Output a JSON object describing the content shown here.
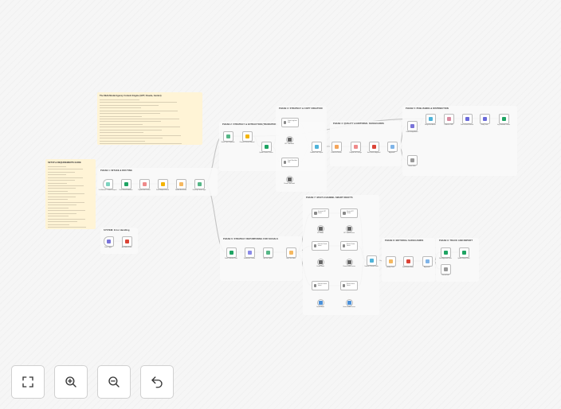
{
  "sticky_notes": [
    {
      "id": "note-main",
      "title": "The Multi-Modal Agency Content Engine (GPT, Claude, Gemini)",
      "lines": [
        "",
        "",
        "",
        "",
        "",
        "",
        "",
        "",
        "",
        "",
        "",
        "",
        "",
        "",
        "",
        "",
        "",
        ""
      ]
    },
    {
      "id": "note-setup",
      "title": "SETUP & REQUIREMENTS GUIDE",
      "lines": [
        "",
        "",
        "",
        "",
        "",
        "",
        "",
        "",
        "",
        "",
        "",
        "",
        "",
        "",
        "",
        "",
        "",
        "",
        "",
        "",
        "",
        "",
        "",
        ""
      ]
    }
  ],
  "groups": [
    {
      "id": "g1",
      "title": "PHASE 1: INTAKE & ROUTING"
    },
    {
      "id": "g2",
      "title": "PHASE 2: STRATEGY & EXTRACTION (TRANSITION)"
    },
    {
      "id": "g3",
      "title": "PHASE 3: STRATEGY & COPY CREATION"
    },
    {
      "id": "g4",
      "title": "PHASE 4: QUALITY & EDITORIAL SAFEGUARDS"
    },
    {
      "id": "g5",
      "title": "PHASE 5: PUBLISHING & DISTRIBUTION"
    },
    {
      "id": "gerr",
      "title": "SYSTEM: Error Handling"
    },
    {
      "id": "g6",
      "title": "PHASE 6: STRATEGY REPURPOSING FOR SOCIALS"
    },
    {
      "id": "g7",
      "title": "PHASE 7: MULTI-CHANNEL SMART DRAFTS"
    },
    {
      "id": "g8",
      "title": "PHASE 8: EDITORIAL SAFEGUARDS"
    },
    {
      "id": "g9",
      "title": "PHASE 9: TRACK AND REPORT"
    }
  ],
  "nodes": [
    {
      "id": "n1",
      "type": "trigger",
      "label": "On Webhook / Content Request",
      "icon": "webhook-icon",
      "color": "#7dd3c0"
    },
    {
      "id": "n2",
      "label": "Fetch Brand Guidelines",
      "icon": "sheets-icon",
      "color": "#1fa463"
    },
    {
      "id": "n3",
      "label": "Prepare Brief Context",
      "icon": "code-icon",
      "color": "#ef8a8a"
    },
    {
      "id": "n4",
      "label": "Store Request Record",
      "icon": "drive-icon",
      "color": "#f4b400"
    },
    {
      "id": "n5",
      "label": "Validate Brief Fields",
      "icon": "filter-icon",
      "color": "#f5b860"
    },
    {
      "id": "n6",
      "label": "Route By Content Type",
      "icon": "switch-icon",
      "color": "#55b686"
    },
    {
      "id": "n7",
      "label": "Extract Topic Keywords",
      "icon": "ai-icon",
      "color": "#55b686"
    },
    {
      "id": "n8",
      "label": "Research Source Material",
      "icon": "drive-icon",
      "color": "#f4b400"
    },
    {
      "id": "n9",
      "label": "Update Content Tracker",
      "icon": "sheets-icon",
      "color": "#1fa463"
    },
    {
      "id": "n10",
      "type": "agent",
      "label": "Create Long-form Draft",
      "icon": "agent-icon",
      "color": "#888"
    },
    {
      "id": "n11",
      "type": "sub",
      "label": "GPT Chat Model",
      "icon": "openai-icon",
      "color": "#666"
    },
    {
      "id": "n12",
      "type": "agent",
      "label": "Create Short-form Draft",
      "icon": "agent-icon",
      "color": "#888"
    },
    {
      "id": "n13",
      "type": "sub",
      "label": "Claude Chat Model",
      "icon": "anthropic-icon",
      "color": "#666"
    },
    {
      "id": "n14",
      "label": "Combine Draft Outputs",
      "icon": "merge-icon",
      "color": "#4fb3d9"
    },
    {
      "id": "n15",
      "label": "Format for Review",
      "icon": "code-icon",
      "color": "#f5a55a"
    },
    {
      "id": "n16",
      "label": "Compile Full Package",
      "icon": "code-icon",
      "color": "#ef8a8a"
    },
    {
      "id": "n17",
      "label": "Send Draft for Approval",
      "icon": "gmail-icon",
      "color": "#db4437"
    },
    {
      "id": "n18",
      "label": "Approved?",
      "icon": "if-icon",
      "color": "#7fb4e8"
    },
    {
      "id": "n19",
      "label": "Create Image Assets",
      "icon": "image-icon",
      "color": "#7a74d9"
    },
    {
      "id": "n20",
      "label": "Revise Draft",
      "icon": "edit-icon",
      "color": "#999"
    },
    {
      "id": "n21",
      "label": "Merge Final Assets",
      "icon": "merge-icon",
      "color": "#4fb3d9"
    },
    {
      "id": "n22",
      "label": "Publish to CMS",
      "icon": "wordpress-icon",
      "color": "#d98aa0"
    },
    {
      "id": "n23",
      "label": "Post to Social Channel",
      "icon": "http-icon",
      "color": "#6a6ad9"
    },
    {
      "id": "n24",
      "label": "Notify Team",
      "icon": "http-icon",
      "color": "#6a6ad9"
    },
    {
      "id": "n25",
      "label": "Log Published Content",
      "icon": "sheets-icon",
      "color": "#1fa463"
    },
    {
      "id": "e1",
      "type": "trigger",
      "label": "Error Trigger",
      "icon": "error-icon",
      "color": "#7a74d9"
    },
    {
      "id": "e2",
      "label": "Alert Admin Email",
      "icon": "gmail-icon",
      "color": "#db4437"
    },
    {
      "id": "p1",
      "label": "Fetch Published Posts",
      "icon": "sheets-icon",
      "color": "#1fa463"
    },
    {
      "id": "p2",
      "label": "Summarise Content",
      "icon": "ai-icon",
      "color": "#8a8ae8"
    },
    {
      "id": "p3",
      "label": "Split Into Topics",
      "icon": "split-icon",
      "color": "#55b686"
    },
    {
      "id": "p4",
      "label": "Loop Over Items",
      "icon": "loop-icon",
      "color": "#f5b860"
    },
    {
      "id": "a1",
      "type": "agent",
      "label": "Generate GPT Variant",
      "icon": "agent-icon",
      "color": "#888"
    },
    {
      "id": "a2",
      "type": "agent",
      "label": "Review GPT Variant",
      "icon": "agent-icon",
      "color": "#888"
    },
    {
      "id": "s1",
      "type": "sub",
      "label": "GPT Model",
      "icon": "openai-icon",
      "color": "#666"
    },
    {
      "id": "s2",
      "type": "sub",
      "label": "GPT Model Review",
      "icon": "openai-icon",
      "color": "#666"
    },
    {
      "id": "a3",
      "type": "agent",
      "label": "Generate Claude Variant",
      "icon": "agent-icon",
      "color": "#888"
    },
    {
      "id": "a4",
      "type": "agent",
      "label": "Review Claude Variant",
      "icon": "agent-icon",
      "color": "#888"
    },
    {
      "id": "s3",
      "type": "sub",
      "label": "Claude Model",
      "icon": "anthropic-icon",
      "color": "#666"
    },
    {
      "id": "s4",
      "type": "sub",
      "label": "Claude Model Review",
      "icon": "anthropic-icon",
      "color": "#666"
    },
    {
      "id": "a5",
      "type": "agent",
      "label": "Generate Gemini Variant",
      "icon": "agent-icon",
      "color": "#888"
    },
    {
      "id": "a6",
      "type": "agent",
      "label": "Review Gemini Variant",
      "icon": "agent-icon",
      "color": "#888"
    },
    {
      "id": "s5",
      "type": "sub",
      "label": "Gemini Model",
      "icon": "gemini-icon",
      "color": "#4a90d9"
    },
    {
      "id": "s6",
      "type": "sub",
      "label": "Gemini Model Review",
      "icon": "gemini-icon",
      "color": "#4a90d9"
    },
    {
      "id": "m1",
      "label": "Combine Channel Drafts",
      "icon": "merge-icon",
      "color": "#4fb3d9"
    },
    {
      "id": "q1",
      "label": "Quality Check",
      "icon": "filter-icon",
      "color": "#f5b860"
    },
    {
      "id": "q2",
      "label": "Send Review Email",
      "icon": "gmail-icon",
      "color": "#db4437"
    },
    {
      "id": "q3",
      "label": "Approved?",
      "icon": "if-icon",
      "color": "#7fb4e8"
    },
    {
      "id": "t1",
      "label": "Save Approved Drafts",
      "icon": "sheets-icon",
      "color": "#1fa463"
    },
    {
      "id": "t2",
      "label": "Update Report Sheet",
      "icon": "sheets-icon",
      "color": "#1fa463"
    },
    {
      "id": "t3",
      "label": "Discard Draft",
      "icon": "noop-icon",
      "color": "#999"
    }
  ],
  "controls": [
    {
      "id": "fit-view",
      "icon": "fullscreen-icon",
      "title": "Fit view"
    },
    {
      "id": "zoom-in",
      "icon": "zoom-in-icon",
      "title": "Zoom in"
    },
    {
      "id": "zoom-out",
      "icon": "zoom-out-icon",
      "title": "Zoom out"
    },
    {
      "id": "reset",
      "icon": "undo-icon",
      "title": "Reset zoom"
    }
  ]
}
